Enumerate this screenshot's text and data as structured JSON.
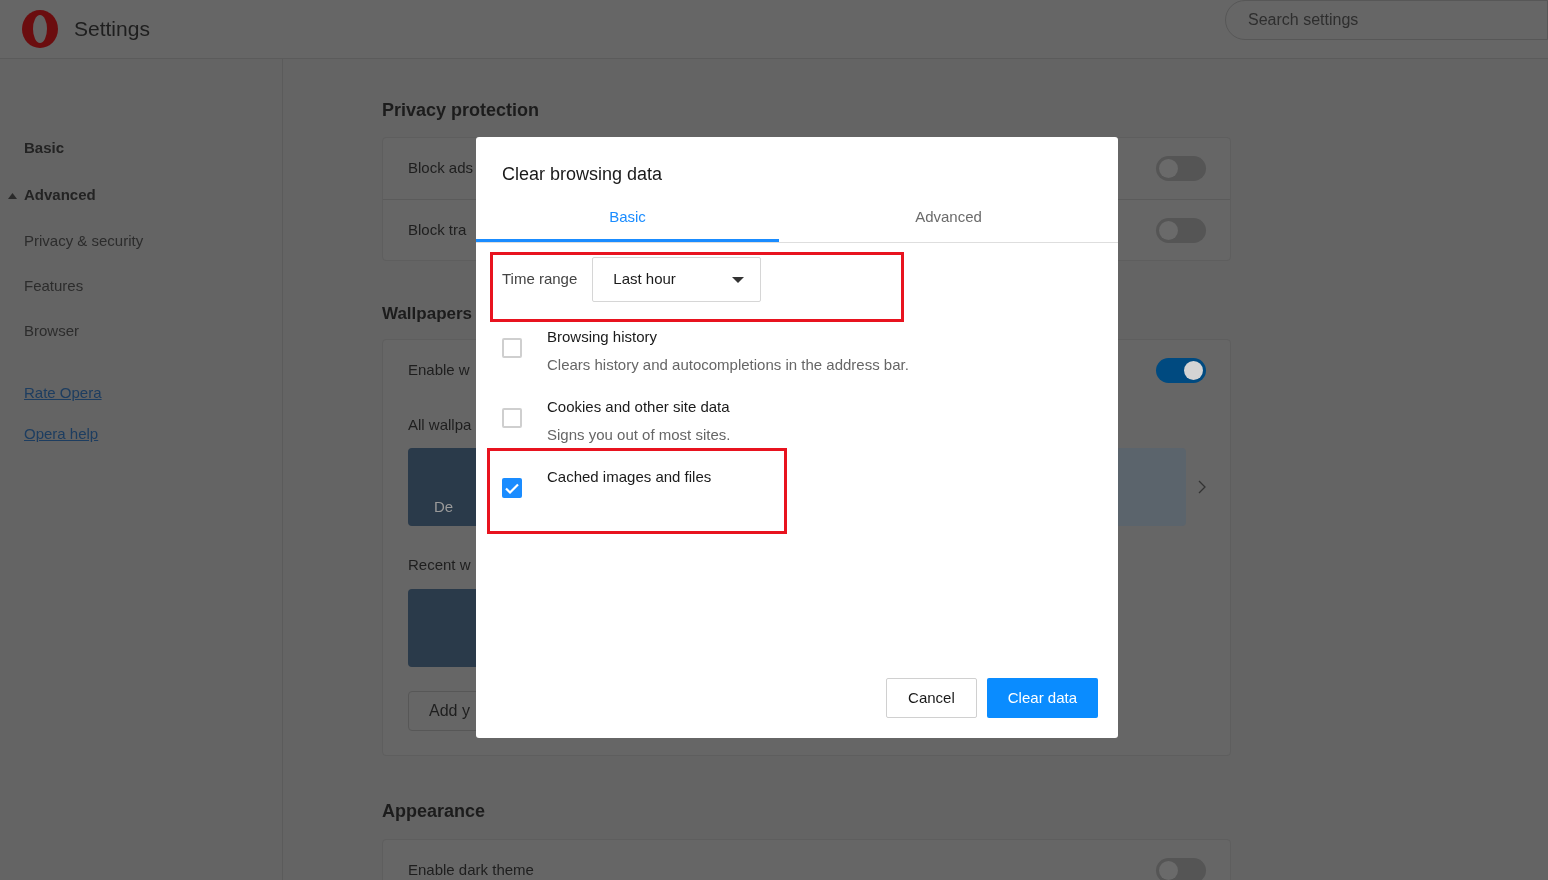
{
  "header": {
    "title": "Settings",
    "search": {
      "placeholder": "Search settings"
    }
  },
  "sidebar": {
    "sections": [
      {
        "label": "Basic"
      },
      {
        "label": "Advanced",
        "expanded": true,
        "children": [
          {
            "label": "Privacy & security"
          },
          {
            "label": "Features"
          },
          {
            "label": "Browser"
          }
        ]
      }
    ],
    "links": [
      "Rate Opera",
      "Opera help"
    ]
  },
  "privacy": {
    "title": "Privacy protection",
    "rows": [
      {
        "label": "Block ads",
        "on": false
      },
      {
        "label": "Block tra",
        "on": false
      }
    ]
  },
  "wallpapers": {
    "title": "Wallpapers",
    "toggle": {
      "label": "Enable w",
      "on": true
    },
    "all_label": "All wallpa",
    "thumb_caption": "De",
    "recent_label": "Recent w",
    "add_button": "Add y"
  },
  "appearance": {
    "title": "Appearance",
    "rows": [
      {
        "label": "Enable dark theme",
        "on": false
      }
    ]
  },
  "dialog": {
    "title": "Clear browsing data",
    "tabs": [
      {
        "label": "Basic",
        "selected": true
      },
      {
        "label": "Advanced",
        "selected": false
      }
    ],
    "time_range": {
      "label": "Time range",
      "value": "Last hour"
    },
    "options": [
      {
        "label": "Browsing history",
        "description": "Clears history and autocompletions in the address bar.",
        "checked": false
      },
      {
        "label": "Cookies and other site data",
        "description": "Signs you out of most sites.",
        "checked": false
      },
      {
        "label": "Cached images and files",
        "checked": true
      }
    ],
    "buttons": [
      {
        "label": "Cancel",
        "kind": "secondary"
      },
      {
        "label": "Clear data",
        "kind": "primary"
      }
    ]
  }
}
